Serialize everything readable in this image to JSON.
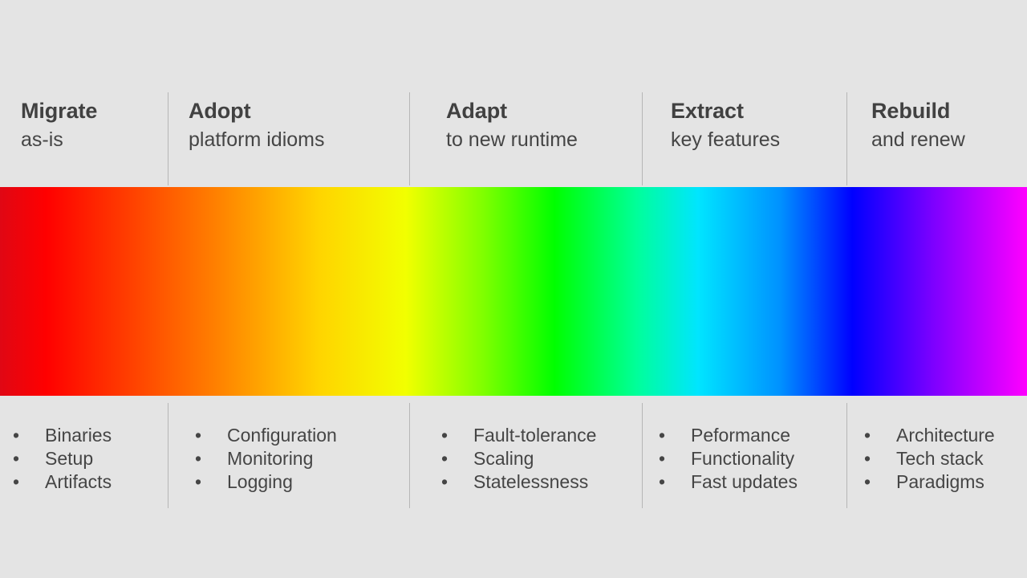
{
  "canvas": {
    "background_color": "#e4e4e4",
    "text_color": "#444444",
    "divider_color": "#b6b6b6"
  },
  "spectrum": {
    "name": "rainbow-spectrum-band",
    "start_color": "#e00714",
    "end_color": "#ff00ff",
    "stops": [
      "#e00714",
      "#ff0000",
      "#ff8000",
      "#ffd400",
      "#f2ff00",
      "#80ff00",
      "#00ff00",
      "#00ff9a",
      "#00e5ff",
      "#0091ff",
      "#0000ff",
      "#7f00ff",
      "#ff00ff"
    ]
  },
  "strategies": [
    {
      "title": "Migrate",
      "subtitle": "as-is",
      "concerns": [
        "Binaries",
        "Setup",
        "Artifacts"
      ]
    },
    {
      "title": "Adopt",
      "subtitle": "platform idioms",
      "concerns": [
        "Configuration",
        "Monitoring",
        "Logging"
      ]
    },
    {
      "title": "Adapt",
      "subtitle": "to new runtime",
      "concerns": [
        "Fault-tolerance",
        "Scaling",
        "Statelessness"
      ]
    },
    {
      "title": "Extract",
      "subtitle": "key features",
      "concerns": [
        "Peformance",
        "Functionality",
        "Fast updates"
      ]
    },
    {
      "title": "Rebuild",
      "subtitle": "and renew",
      "concerns": [
        "Architecture",
        "Tech stack",
        "Paradigms"
      ]
    }
  ],
  "bullet_glyph": "•"
}
